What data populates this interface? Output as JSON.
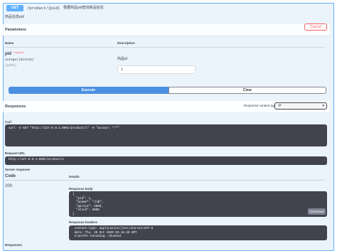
{
  "operation": {
    "method": "GET",
    "path": "/product/{pid}",
    "summary": "根据商品pid查询商品信息",
    "description": "商品信息pid"
  },
  "parameters": {
    "title": "Parameters",
    "cancel_label": "Cancel",
    "col_name": "Name",
    "col_description": "Description",
    "param": {
      "name": "pid",
      "required_marker": "* required",
      "type": "integer($int32)",
      "location": "(path)",
      "description": "商品id",
      "value": "1"
    }
  },
  "actions": {
    "execute_label": "Execute",
    "clear_label": "Clear"
  },
  "responses": {
    "title": "Responses",
    "content_type_label": "Response content type",
    "content_type_value": "*/*",
    "curl_label": "Curl",
    "curl_command": "curl -X GET \"http://127.0.0.1:8081/product/1\" -H \"accept: */*\"",
    "request_url_label": "Request URL",
    "request_url": "http://127.0.0.1:8081/product/1",
    "server_response_label": "Server response",
    "code_header": "Code",
    "details_header": "Details",
    "code": "200",
    "body_label": "Response body",
    "body": "{\n  \"pid\": 1,\n  \"pname\": \"小米\",\n  \"pprice\": 1000,\n  \"stock\": 5000\n}",
    "download_label": "Download",
    "headers_label": "Response headers",
    "headers": " content-type: application/json;charset=UTF-8 \n date: Thu, 20 Oct 2020 02:16:49 GMT \n transfer-encoding: chunked ",
    "bottom_label": "Responses"
  }
}
